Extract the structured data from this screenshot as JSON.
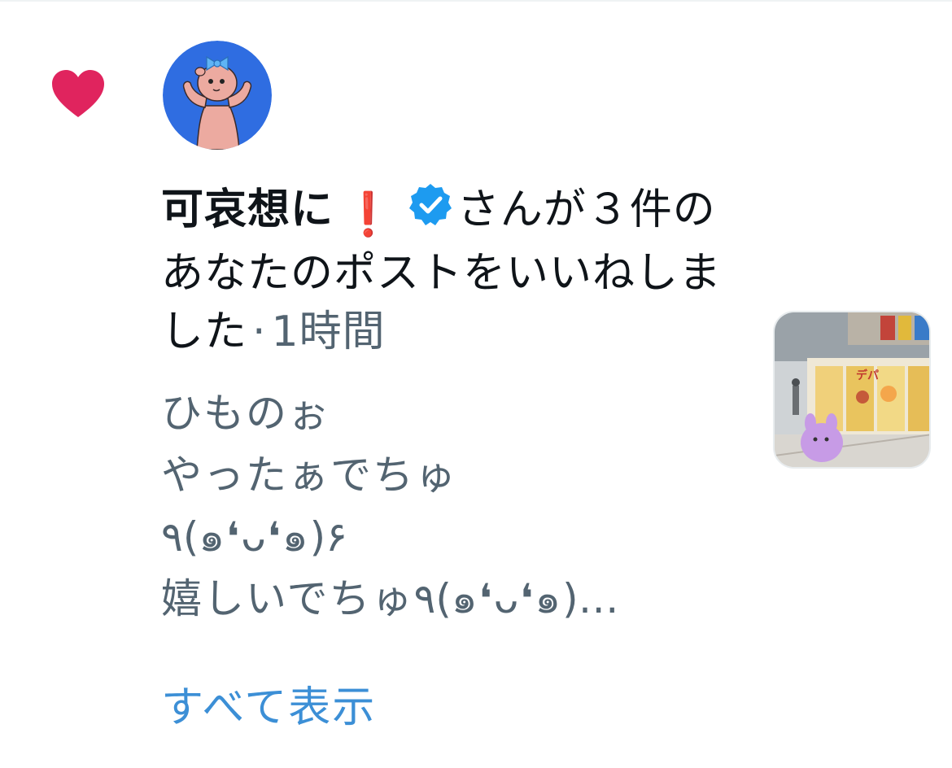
{
  "notification": {
    "type_icon": "heart-icon",
    "actor_name": "可哀想に",
    "actor_emoji": "❗",
    "verified_icon": "verified-badge-icon",
    "action_text": "さんが３件のあなたのポストをいいねしました",
    "separator": "·",
    "time": "1時間"
  },
  "post_preview": {
    "lines": [
      "ひものぉ",
      "やったぁでちゅ",
      "٩(๑❛ᴗ❛๑)۶",
      "嬉しいでちゅ٩(๑❛ᴗ❛๑)…"
    ]
  },
  "show_all_label": "すべて表示",
  "colors": {
    "heart": "#e0245e",
    "verified": "#1d9bf0",
    "link": "#3c8fd6",
    "secondary_text": "#536471",
    "primary_text": "#0f1419",
    "avatar_bg": "#2f6de1"
  }
}
